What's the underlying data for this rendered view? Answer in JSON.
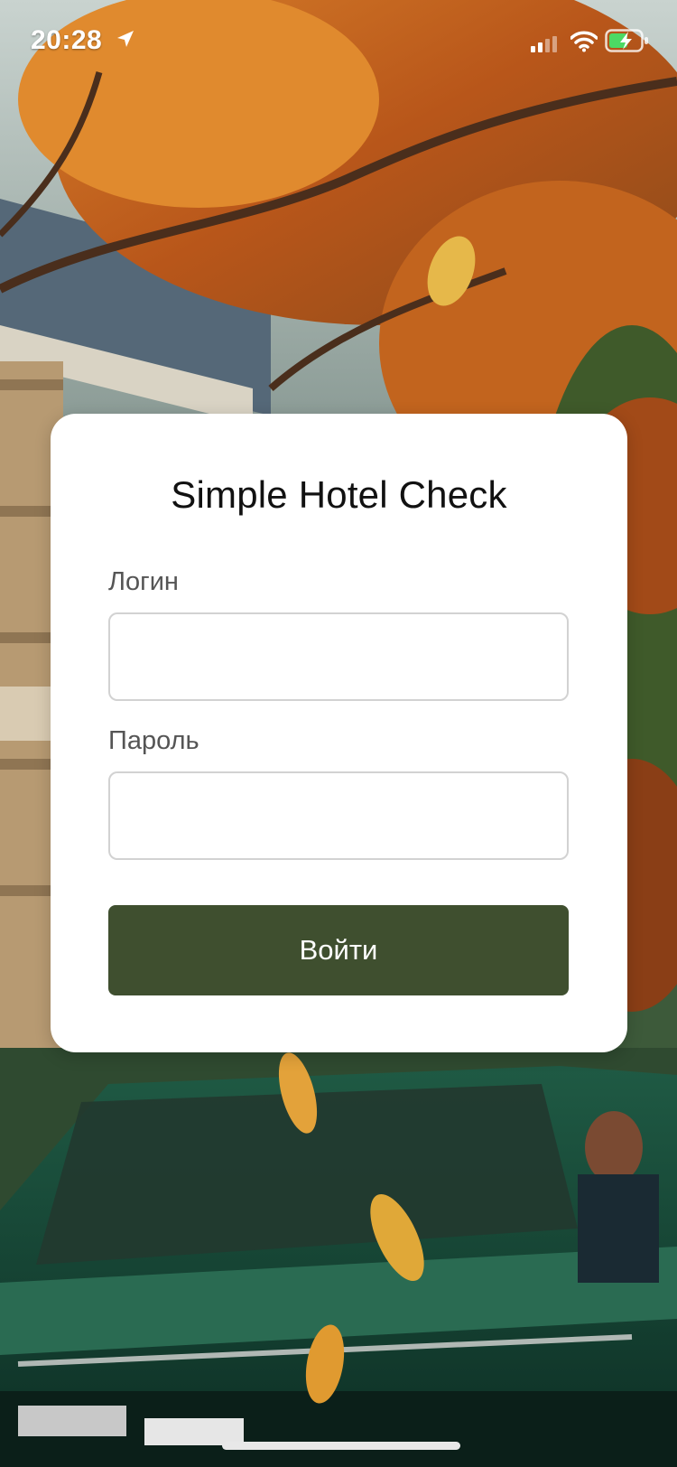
{
  "status_bar": {
    "time": "20:28",
    "icons": [
      "location-arrow-icon",
      "cellular-signal-icon",
      "wifi-icon",
      "battery-charging-icon"
    ]
  },
  "background": {
    "description_icon": "autumn-house-car-photo"
  },
  "login_card": {
    "title": "Simple Hotel Check",
    "login_label": "Логин",
    "login_value": "",
    "password_label": "Пароль",
    "password_value": "",
    "submit_label": "Войти"
  },
  "colors": {
    "button": "#3f4f2f",
    "card": "#ffffff",
    "title": "#111111",
    "label": "#555555",
    "input_border": "#d2d2d2"
  }
}
